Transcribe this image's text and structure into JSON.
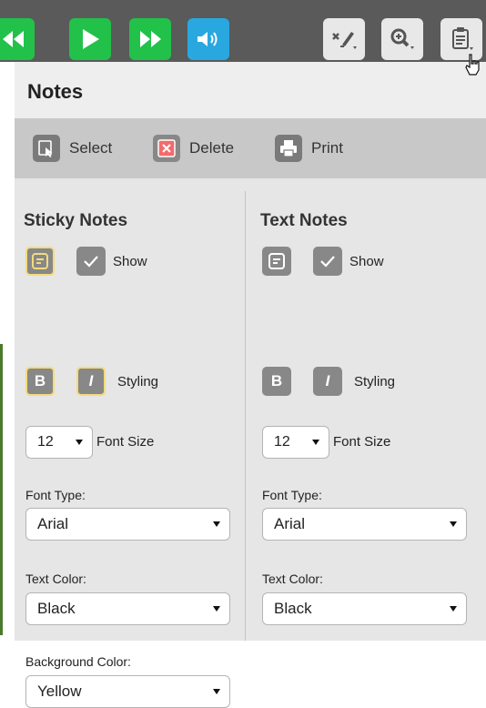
{
  "toolbar": {
    "buttons": [
      {
        "name": "rewind",
        "icon": "rewind-icon",
        "color": "#22c14a"
      },
      {
        "name": "play",
        "icon": "play-icon",
        "color": "#22c14a"
      },
      {
        "name": "fast-forward",
        "icon": "fast-forward-icon",
        "color": "#22c14a"
      },
      {
        "name": "audio",
        "icon": "speaker-icon",
        "color": "#29a8e0"
      },
      {
        "name": "annotate",
        "icon": "pen-tools-icon",
        "color": "#e8e8e8"
      },
      {
        "name": "zoom",
        "icon": "zoom-in-icon",
        "color": "#e8e8e8"
      },
      {
        "name": "notes",
        "icon": "clipboard-icon",
        "color": "#e8e8e8"
      }
    ]
  },
  "panel": {
    "title": "Notes",
    "actions": {
      "select_label": "Select",
      "delete_label": "Delete",
      "print_label": "Print"
    }
  },
  "sticky": {
    "title": "Sticky Notes",
    "show_label": "Show",
    "show_checked": true,
    "bold_label": "B",
    "italic_label": "I",
    "styling_label": "Styling",
    "font_size_value": "12",
    "font_size_label": "Font Size",
    "font_type_label": "Font Type:",
    "font_type_value": "Arial",
    "text_color_label": "Text Color:",
    "text_color_value": "Black",
    "bg_color_label": "Background Color:",
    "bg_color_value": "Yellow"
  },
  "text": {
    "title": "Text Notes",
    "show_label": "Show",
    "show_checked": true,
    "bold_label": "B",
    "italic_label": "I",
    "styling_label": "Styling",
    "font_size_value": "12",
    "font_size_label": "Font Size",
    "font_type_label": "Font Type:",
    "font_type_value": "Arial",
    "text_color_label": "Text Color:",
    "text_color_value": "Black"
  },
  "colors": {
    "green": "#22c14a",
    "blue": "#29a8e0",
    "panel_bg": "#e6e6e6",
    "actionbar_bg": "#c8c8c8",
    "highlight_border": "#f2dc7a"
  }
}
